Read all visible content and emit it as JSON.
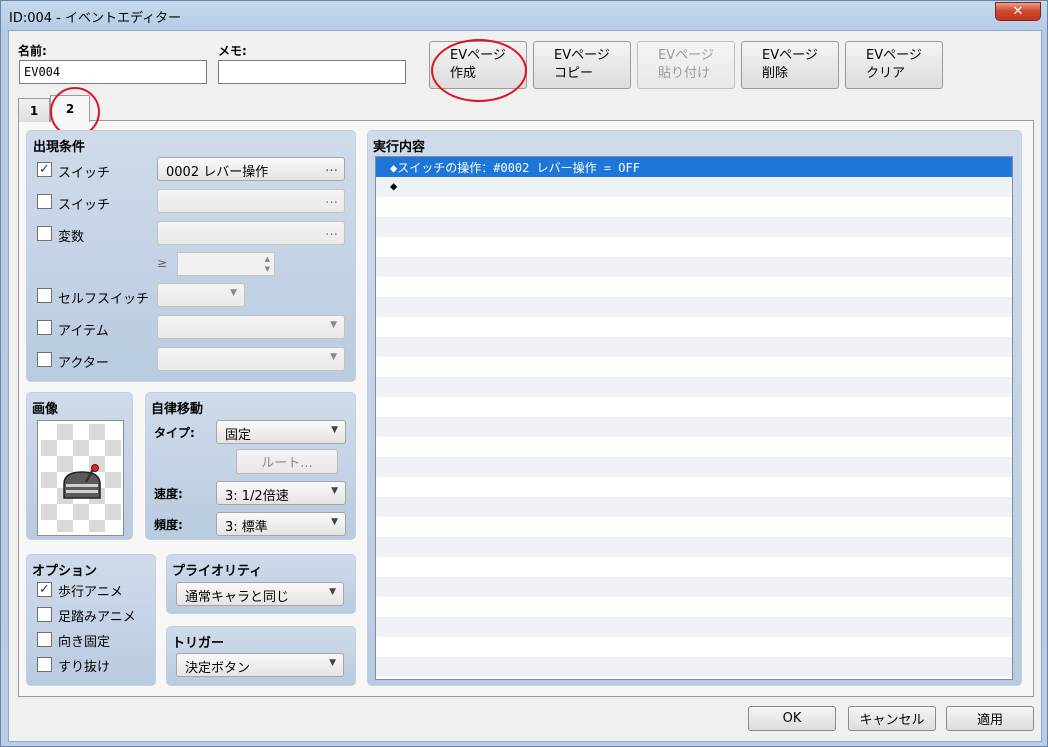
{
  "window": {
    "title": "ID:004 - イベントエディター",
    "close_label": "✕"
  },
  "header": {
    "name_label": "名前:",
    "name_value": "EV004",
    "memo_label": "メモ:",
    "memo_value": ""
  },
  "page_buttons": [
    {
      "line1": "EVページ",
      "line2": "作成",
      "enabled": true
    },
    {
      "line1": "EVページ",
      "line2": "コピー",
      "enabled": true
    },
    {
      "line1": "EVページ",
      "line2": "貼り付け",
      "enabled": false
    },
    {
      "line1": "EVページ",
      "line2": "削除",
      "enabled": true
    },
    {
      "line1": "EVページ",
      "line2": "クリア",
      "enabled": true
    }
  ],
  "tabs": [
    {
      "label": "1",
      "active": false
    },
    {
      "label": "2",
      "active": true
    }
  ],
  "conditions": {
    "title": "出現条件",
    "switch1": {
      "label": "スイッチ",
      "checked": true,
      "check_glyph": "✓",
      "value": "0002 レバー操作",
      "button": "…"
    },
    "switch2": {
      "label": "スイッチ",
      "checked": false,
      "value": "",
      "button": "…"
    },
    "variable": {
      "label": "変数",
      "checked": false,
      "value": "",
      "button": "…",
      "compare": "≥",
      "amount": ""
    },
    "self_switch": {
      "label": "セルフスイッチ",
      "checked": false,
      "value": ""
    },
    "item": {
      "label": "アイテム",
      "checked": false,
      "value": ""
    },
    "actor": {
      "label": "アクター",
      "checked": false,
      "value": ""
    }
  },
  "image": {
    "title": "画像",
    "sprite_icon": "lever-sprite-icon"
  },
  "autonomous": {
    "title": "自律移動",
    "type_label": "タイプ:",
    "type_value": "固定",
    "route_button": "ルート...",
    "speed_label": "速度:",
    "speed_value": "3: 1/2倍速",
    "frequency_label": "頻度:",
    "frequency_value": "3: 標準"
  },
  "options": {
    "title": "オプション",
    "walking_anime": {
      "label": "歩行アニメ",
      "checked": true,
      "check_glyph": "✓"
    },
    "stepping_anime": {
      "label": "足踏みアニメ",
      "checked": false
    },
    "direction_fix": {
      "label": "向き固定",
      "checked": false
    },
    "through": {
      "label": "すり抜け",
      "checked": false
    }
  },
  "priority": {
    "title": "プライオリティ",
    "value": "通常キャラと同じ"
  },
  "trigger": {
    "title": "トリガー",
    "value": "決定ボタン"
  },
  "contents": {
    "title": "実行内容",
    "rows": [
      "◆スイッチの操作：#0002 レバー操作 = OFF",
      "◆"
    ]
  },
  "footer": {
    "ok": "OK",
    "cancel": "キャンセル",
    "apply": "適用"
  },
  "colors": {
    "selection": "#1e76d9",
    "annotation": "#e0141e",
    "group_bg": "#c6d5e8"
  }
}
